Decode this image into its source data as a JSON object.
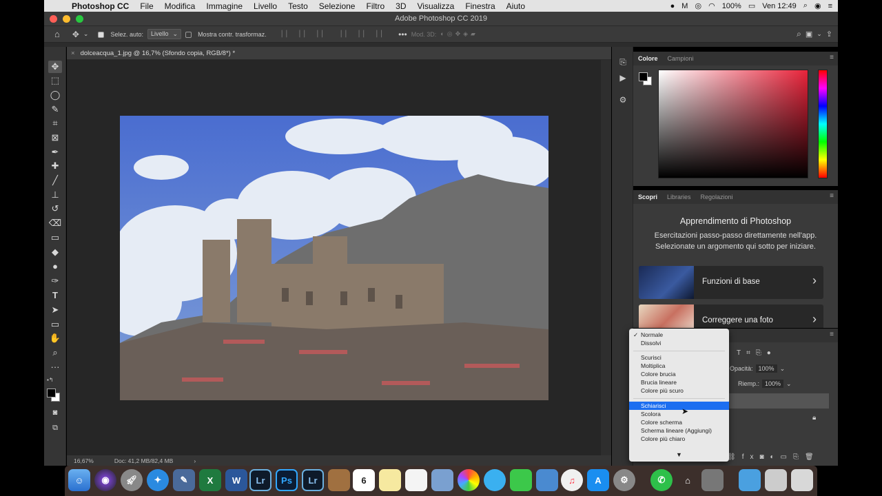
{
  "menubar": {
    "app_name": "Photoshop CC",
    "items": [
      "File",
      "Modifica",
      "Immagine",
      "Livello",
      "Testo",
      "Selezione",
      "Filtro",
      "3D",
      "Visualizza",
      "Finestra",
      "Aiuto"
    ],
    "battery": "100%",
    "clock": "Ven 12:49"
  },
  "window": {
    "title": "Adobe Photoshop CC 2019"
  },
  "options_bar": {
    "auto_select_label": "Selez. auto:",
    "auto_select_value": "Livello",
    "show_transform_label": "Mostra contr. trasformaz.",
    "mode_3d_label": "Mod. 3D:"
  },
  "document": {
    "tab_title": "dolceacqua_1.jpg @ 16,7% (Sfondo copia, RGB/8*) *"
  },
  "status": {
    "zoom": "16,67%",
    "doc_size": "Doc: 41,2 MB/82,4 MB"
  },
  "color_panel": {
    "tabs": [
      "Colore",
      "Campioni"
    ],
    "foreground": "#000000",
    "background": "#ffffff"
  },
  "learn_panel": {
    "tabs": [
      "Scopri",
      "Libraries",
      "Regolazioni"
    ],
    "heading": "Apprendimento di Photoshop",
    "description_line1": "Esercitazioni passo-passo direttamente nell'app.",
    "description_line2": "Selezionate un argomento qui sotto per iniziare.",
    "cards": [
      {
        "label": "Funzioni di base"
      },
      {
        "label": "Correggere una foto"
      }
    ]
  },
  "layers_panel": {
    "opacity_label": "Opacità:",
    "opacity_value": "100%",
    "fill_label": "Riemp.:",
    "fill_value": "100%"
  },
  "blend_dropdown": {
    "groups": [
      [
        "Normale",
        "Dissolvi"
      ],
      [
        "Scurisci",
        "Moltiplica",
        "Colore brucia",
        "Brucia lineare",
        "Colore più scuro"
      ],
      [
        "Schiarisci",
        "Scolora",
        "Colore scherma",
        "Scherma lineare (Aggiungi)",
        "Colore più chiaro"
      ]
    ],
    "checked": "Normale",
    "highlighted": "Schiarisci"
  },
  "dock": {
    "labels": [
      "Lr",
      "Ps",
      "Lr",
      "W"
    ],
    "calendar_day": "6"
  }
}
